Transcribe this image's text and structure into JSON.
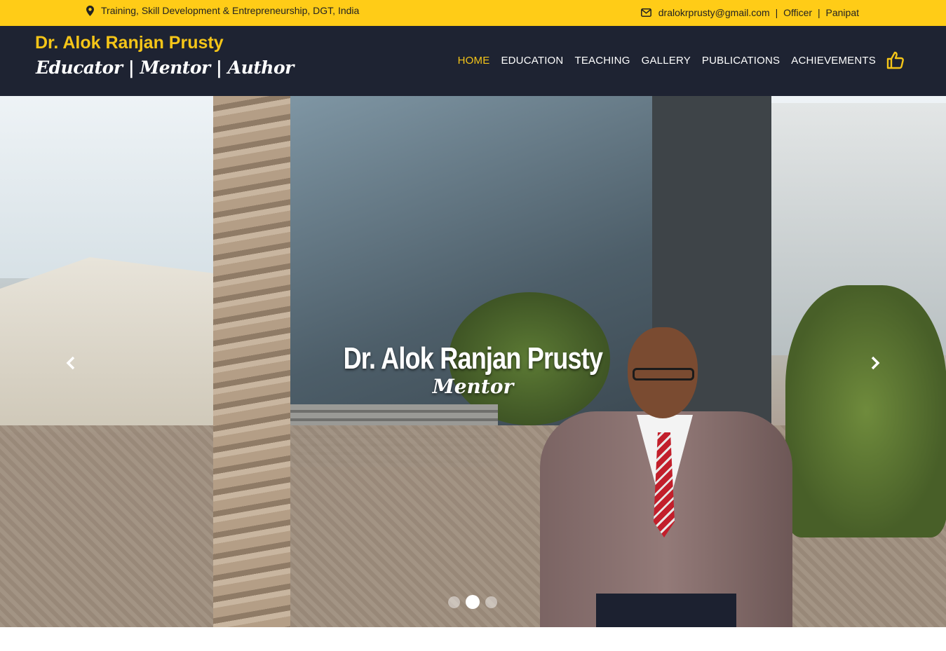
{
  "topbar": {
    "location_icon": "map-marker-icon",
    "location_text": "Training, Skill Development & Entrepreneurship, DGT, India",
    "email_icon": "envelope-icon",
    "email": "dralokrprusty@gmail.com",
    "separator": "|",
    "role": "Officer",
    "place": "Panipat"
  },
  "brand": {
    "name": "Dr. Alok Ranjan Prusty",
    "tagline": "Educator | Mentor | Author"
  },
  "nav": {
    "items": [
      "HOME",
      "EDUCATION",
      "TEACHING",
      "GALLERY",
      "PUBLICATIONS",
      "ACHIEVEMENTS"
    ],
    "active_index": 0,
    "like_icon": "thumbs-up-icon"
  },
  "hero": {
    "title": "Dr. Alok Ranjan Prusty",
    "subtitle": "Mentor",
    "slide_count": 3,
    "active_slide": 2,
    "prev_icon": "chevron-left-icon",
    "next_icon": "chevron-right-icon"
  },
  "colors": {
    "accent": "#f5c518",
    "topbar": "#ffcc17",
    "navbar": "#1e2332"
  }
}
